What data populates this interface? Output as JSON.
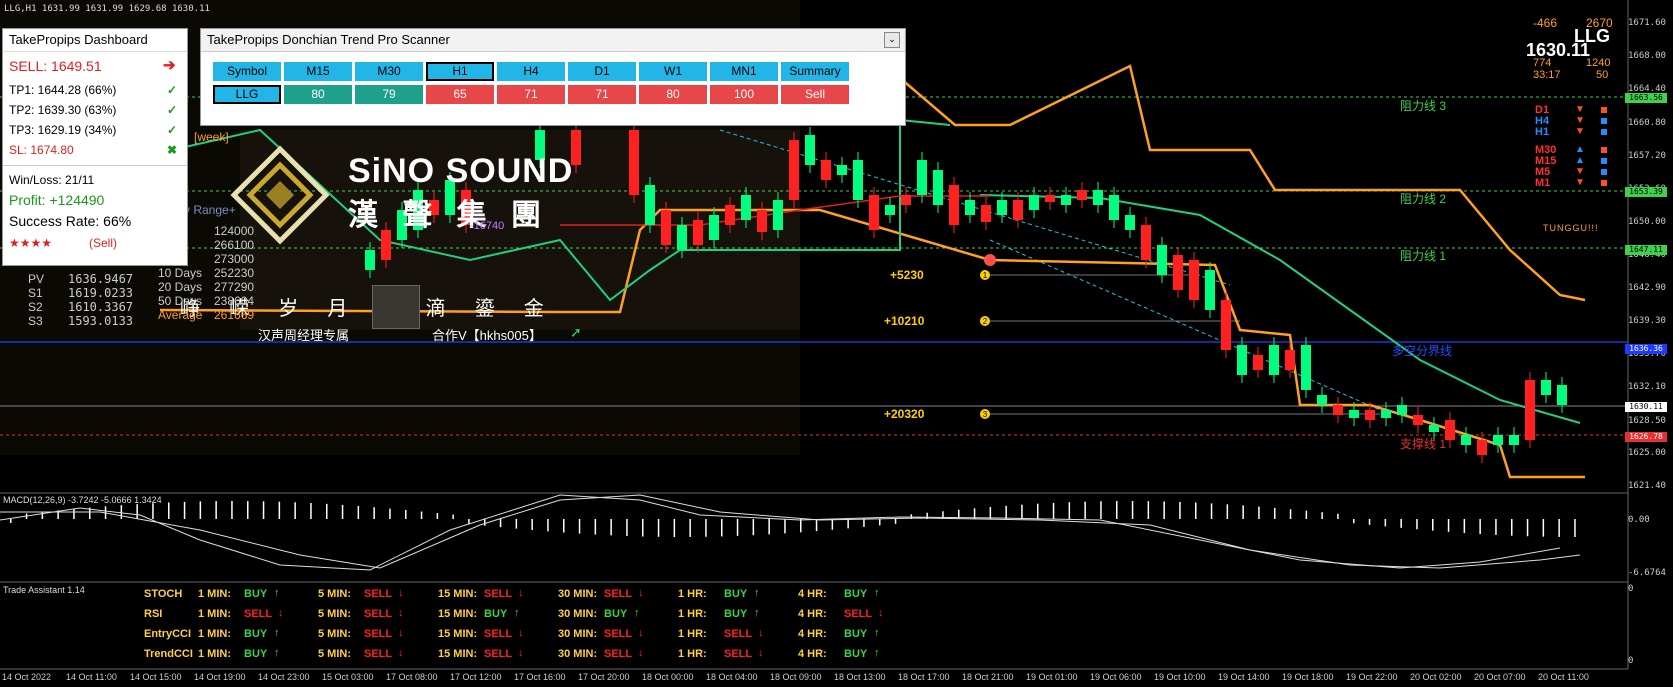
{
  "symbol_info": "LLG,H1  1631.99 1631.99 1629.68 1630.11",
  "dashboard": {
    "title": "TakePropips Dashboard",
    "signal": "SELL: 1649.51",
    "tp1": "TP1: 1644.28 (66%)",
    "tp2": "TP2: 1639.30 (63%)",
    "tp3": "TP3: 1629.19 (34%)",
    "sl": "SL:   1674.80",
    "winloss": "Win/Loss: 21/11",
    "profit": "Profit: +124490",
    "success": "Success Rate: 66%",
    "stars": "★★★★",
    "rating_signal": "(Sell)"
  },
  "scanner": {
    "title": "TakePropips Donchian Trend Pro Scanner",
    "headers": [
      "Symbol",
      "M15",
      "M30",
      "H1",
      "H4",
      "D1",
      "W1",
      "MN1",
      "Summary"
    ],
    "values": [
      "LLG",
      "80",
      "79",
      "65",
      "71",
      "71",
      "80",
      "100",
      "Sell"
    ]
  },
  "overlay": {
    "brand": "SiNO SOUND",
    "brand_cn": "漢 聲 集 團",
    "slogan": "峥  嵘  岁  月  点  滴  鎏  金",
    "manager": "汉声周经理专属",
    "contact": "合作V【hkhs005】",
    "week_label": "[week]",
    "range_label": "y Range+",
    "neg_label": "-16740",
    "pivots": [
      {
        "name": "PV",
        "value": "1636.9467"
      },
      {
        "name": "S1",
        "value": "1619.0233"
      },
      {
        "name": "S2",
        "value": "1610.3367"
      },
      {
        "name": "S3",
        "value": "1593.0133"
      }
    ],
    "ranges": [
      {
        "label": "y",
        "value": "124000"
      },
      {
        "label": "",
        "value": "266100"
      },
      {
        "label": "Days",
        "value": "273000"
      },
      {
        "label": "10 Days",
        "value": "252230"
      },
      {
        "label": "20 Days",
        "value": "277290"
      },
      {
        "label": "50 Days",
        "value": "238604"
      },
      {
        "label": "Average",
        "value": "261669"
      }
    ]
  },
  "targets": [
    "+5230",
    "+10210",
    "+20320"
  ],
  "target_ids": [
    "1",
    "2",
    "3"
  ],
  "levels": {
    "resistance3": "阻力线 3",
    "resistance2": "阻力线 2",
    "resistance1": "阻力线 1",
    "pivot": "多空分界线",
    "support1": "支撑线 1"
  },
  "price_panel": {
    "top_left": "-466",
    "top_right": "2670",
    "symbol": "LLG",
    "price": "1630.11",
    "row2_left": "774",
    "row2_right": "1240",
    "timer": "33:17",
    "timer_right": "50",
    "trend_label": "TUNGGU!!!"
  },
  "tf_arrows": [
    {
      "tf": "D1",
      "color": "#ff3030",
      "arrow": "▼"
    },
    {
      "tf": "H4",
      "color": "#1e90ff",
      "arrow": "▼"
    },
    {
      "tf": "H1",
      "color": "#1e90ff",
      "arrow": "▼"
    },
    {
      "tf": "M30",
      "color": "#ff3030",
      "arrow": "▲"
    },
    {
      "tf": "M15",
      "color": "#ff3030",
      "arrow": "▲"
    },
    {
      "tf": "M5",
      "color": "#ff3030",
      "arrow": "▼"
    },
    {
      "tf": "M1",
      "color": "#ff3030",
      "arrow": "▼"
    }
  ],
  "price_axis": [
    "1671.60",
    "1668.00",
    "1664.40",
    "1660.80",
    "1657.20",
    "1653.60",
    "1650.00",
    "1646.40",
    "1642.90",
    "1639.30",
    "1635.70",
    "1632.10",
    "1628.50",
    "1625.00",
    "1621.40"
  ],
  "price_tags": [
    {
      "value": "1663.56",
      "color": "#3cd34a"
    },
    {
      "value": "1653.39",
      "color": "#3cd34a"
    },
    {
      "value": "1647.11",
      "color": "#3cd34a"
    },
    {
      "value": "1636.36",
      "color": "#1e3cff"
    },
    {
      "value": "1630.11",
      "color": "#ffffff"
    },
    {
      "value": "1626.78",
      "color": "#e83030"
    }
  ],
  "macd": {
    "label": "MACD(12,26,9) -3.7242 -5.0666 1.3424",
    "axis_top": "0.00",
    "axis_bottom": "-6.6764"
  },
  "trade_assistant": {
    "title": "Trade Assistant 1.14",
    "timeframes": [
      "1 MIN:",
      "5 MIN:",
      "15 MIN:",
      "30 MIN:",
      "1 HR:",
      "4 HR:"
    ],
    "rows": [
      {
        "name": "STOCH",
        "signals": [
          "BUY",
          "SELL",
          "SELL",
          "SELL",
          "BUY",
          "BUY"
        ]
      },
      {
        "name": "RSI",
        "signals": [
          "SELL",
          "SELL",
          "BUY",
          "BUY",
          "BUY",
          "SELL"
        ]
      },
      {
        "name": "EntryCCI",
        "signals": [
          "BUY",
          "SELL",
          "SELL",
          "SELL",
          "SELL",
          "BUY"
        ]
      },
      {
        "name": "TrendCCI",
        "signals": [
          "BUY",
          "SELL",
          "SELL",
          "SELL",
          "SELL",
          "BUY"
        ]
      }
    ],
    "axis_top": "0",
    "axis_bottom": "0"
  },
  "time_axis": [
    "14 Oct 2022",
    "14 Oct 11:00",
    "14 Oct 15:00",
    "14 Oct 19:00",
    "14 Oct 23:00",
    "15 Oct 03:00",
    "17 Oct 08:00",
    "17 Oct 12:00",
    "17 Oct 16:00",
    "17 Oct 20:00",
    "18 Oct 00:00",
    "18 Oct 04:00",
    "18 Oct 09:00",
    "18 Oct 13:00",
    "18 Oct 17:00",
    "18 Oct 21:00",
    "19 Oct 01:00",
    "19 Oct 06:00",
    "19 Oct 10:00",
    "19 Oct 14:00",
    "19 Oct 18:00",
    "19 Oct 22:00",
    "20 Oct 02:00",
    "20 Oct 07:00",
    "20 Oct 11:00"
  ],
  "colors": {
    "bull": "#00ff7f",
    "bear": "#ff2020",
    "donchian": "#ffa020",
    "ma_green": "#20d080",
    "ma_red": "#e02020"
  }
}
